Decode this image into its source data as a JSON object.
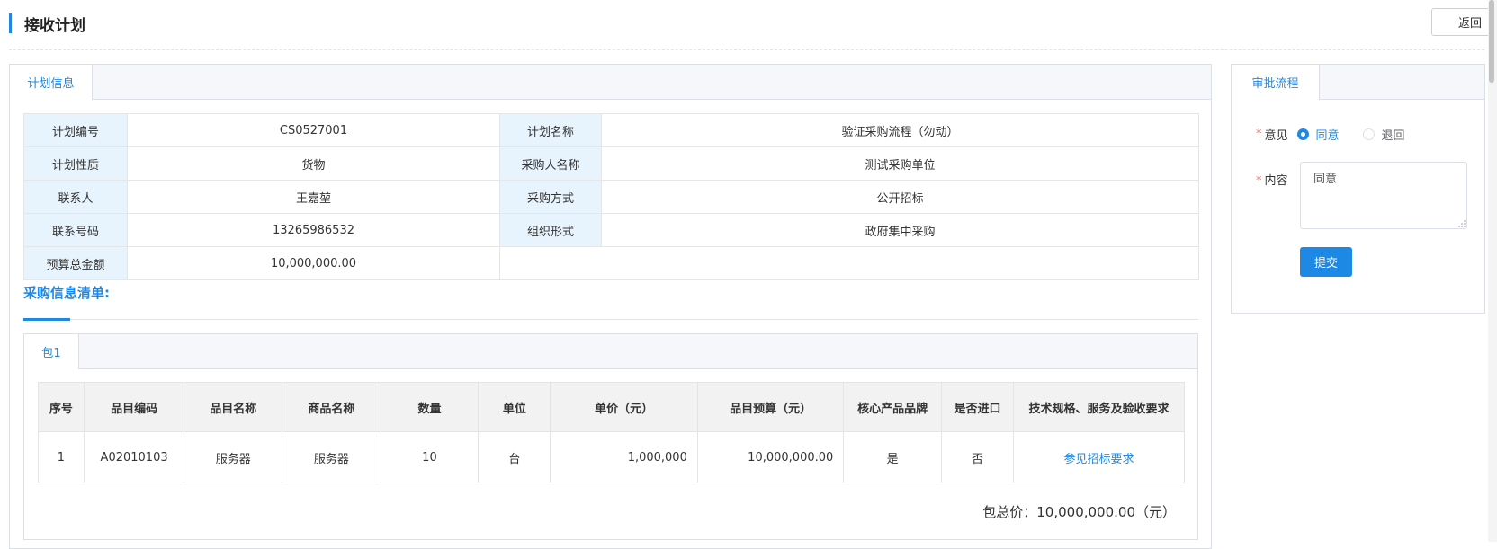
{
  "page": {
    "title": "接收计划",
    "back_label": "返回"
  },
  "plan_panel": {
    "tab": "计划信息",
    "rows": [
      [
        {
          "label": "计划编号",
          "value": "CS0527001"
        },
        {
          "label": "计划名称",
          "value": "验证采购流程（勿动）"
        }
      ],
      [
        {
          "label": "计划性质",
          "value": "货物"
        },
        {
          "label": "采购人名称",
          "value": "测试采购单位"
        }
      ],
      [
        {
          "label": "联系人",
          "value": "王嘉堃"
        },
        {
          "label": "采购方式",
          "value": "公开招标"
        }
      ],
      [
        {
          "label": "联系号码",
          "value": "13265986532"
        },
        {
          "label": "组织形式",
          "value": "政府集中采购"
        }
      ],
      [
        {
          "label": "预算总金额",
          "value": "10,000,000.00"
        }
      ]
    ],
    "section_title": "采购信息清单:"
  },
  "package": {
    "tab": "包1",
    "columns": [
      "序号",
      "品目编码",
      "品目名称",
      "商品名称",
      "数量",
      "单位",
      "单价（元）",
      "品目预算（元）",
      "核心产品品牌",
      "是否进口",
      "技术规格、服务及验收要求"
    ],
    "rows": [
      [
        "1",
        "A02010103",
        "服务器",
        "服务器",
        "10",
        "台",
        "1,000,000",
        "10,000,000.00",
        "是",
        "否",
        "参见招标要求"
      ]
    ],
    "total": "包总价：10,000,000.00（元）"
  },
  "approval": {
    "tab": "审批流程",
    "opinion_label": "意见",
    "options": [
      "同意",
      "退回"
    ],
    "selected": "同意",
    "content_label": "内容",
    "content_value": "同意",
    "submit_label": "提交"
  },
  "colors": {
    "accent": "#1e88e5",
    "label_bg": "#e8f4fd",
    "required": "#f56c6c"
  }
}
